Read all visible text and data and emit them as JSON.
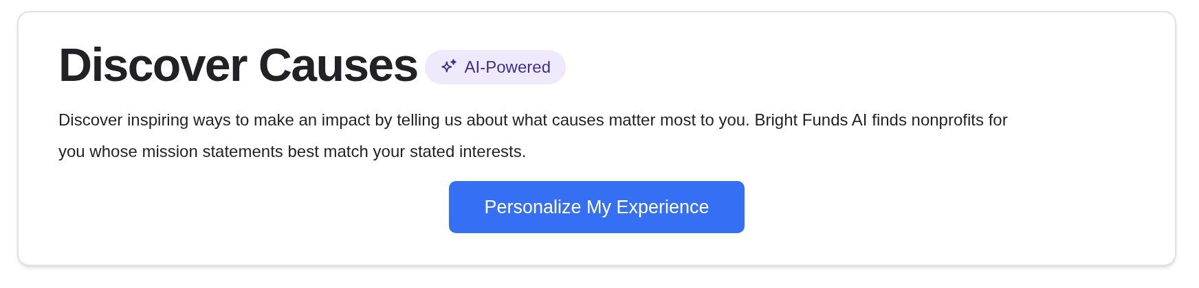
{
  "card": {
    "title": "Discover Causes",
    "badge": "AI-Powered",
    "description": "Discover inspiring ways to make an impact by telling us about what causes matter most to you. Bright Funds AI finds nonprofits for you whose mission statements best match your stated interests.",
    "button": "Personalize My Experience"
  }
}
